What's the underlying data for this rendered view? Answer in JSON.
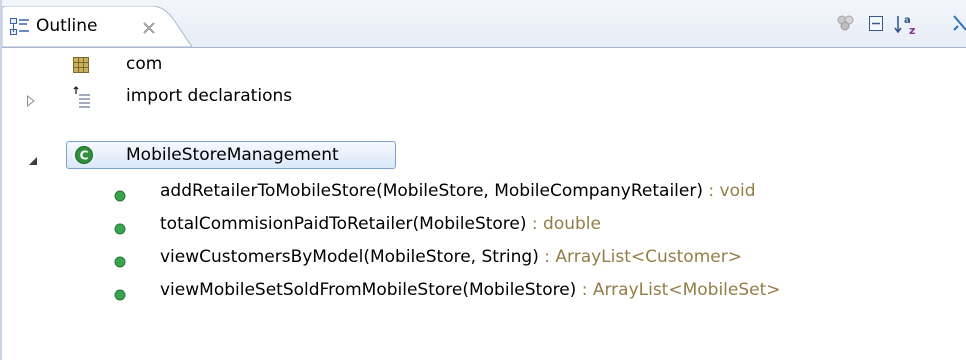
{
  "tab": {
    "title": "Outline",
    "close_glyph": "✕"
  },
  "toolbar": {
    "icons": [
      "hide-fields-icon",
      "collapse-all-icon",
      "sort-alpha-icon",
      "hide-nonpublic-icon"
    ]
  },
  "tree": {
    "items": [
      {
        "label": "com",
        "icon": "package-icon",
        "expandable": false
      },
      {
        "label": "import declarations",
        "icon": "imports-icon",
        "expandable": true,
        "expanded": false
      },
      {
        "label": "MobileStoreManagement",
        "icon": "class-icon",
        "expandable": true,
        "expanded": true,
        "selected": true
      },
      {
        "label": "addRetailerToMobileStore(MobileStore, MobileCompanyRetailer)",
        "ret": " : void",
        "icon": "public-method-icon"
      },
      {
        "label": "totalCommisionPaidToRetailer(MobileStore)",
        "ret": " : double",
        "icon": "public-method-icon"
      },
      {
        "label": "viewCustomersByModel(MobileStore, String)",
        "ret": " : ArrayList<Customer>",
        "icon": "public-method-icon"
      },
      {
        "label": "viewMobileSetSoldFromMobileStore(MobileStore)",
        "ret": " : ArrayList<MobileSet>",
        "icon": "public-method-icon"
      }
    ]
  },
  "colors": {
    "return_type": "#957d47",
    "method_dot": "#3aa350",
    "class_icon": "#2f8f3a",
    "selection_border": "#7da2ce"
  }
}
